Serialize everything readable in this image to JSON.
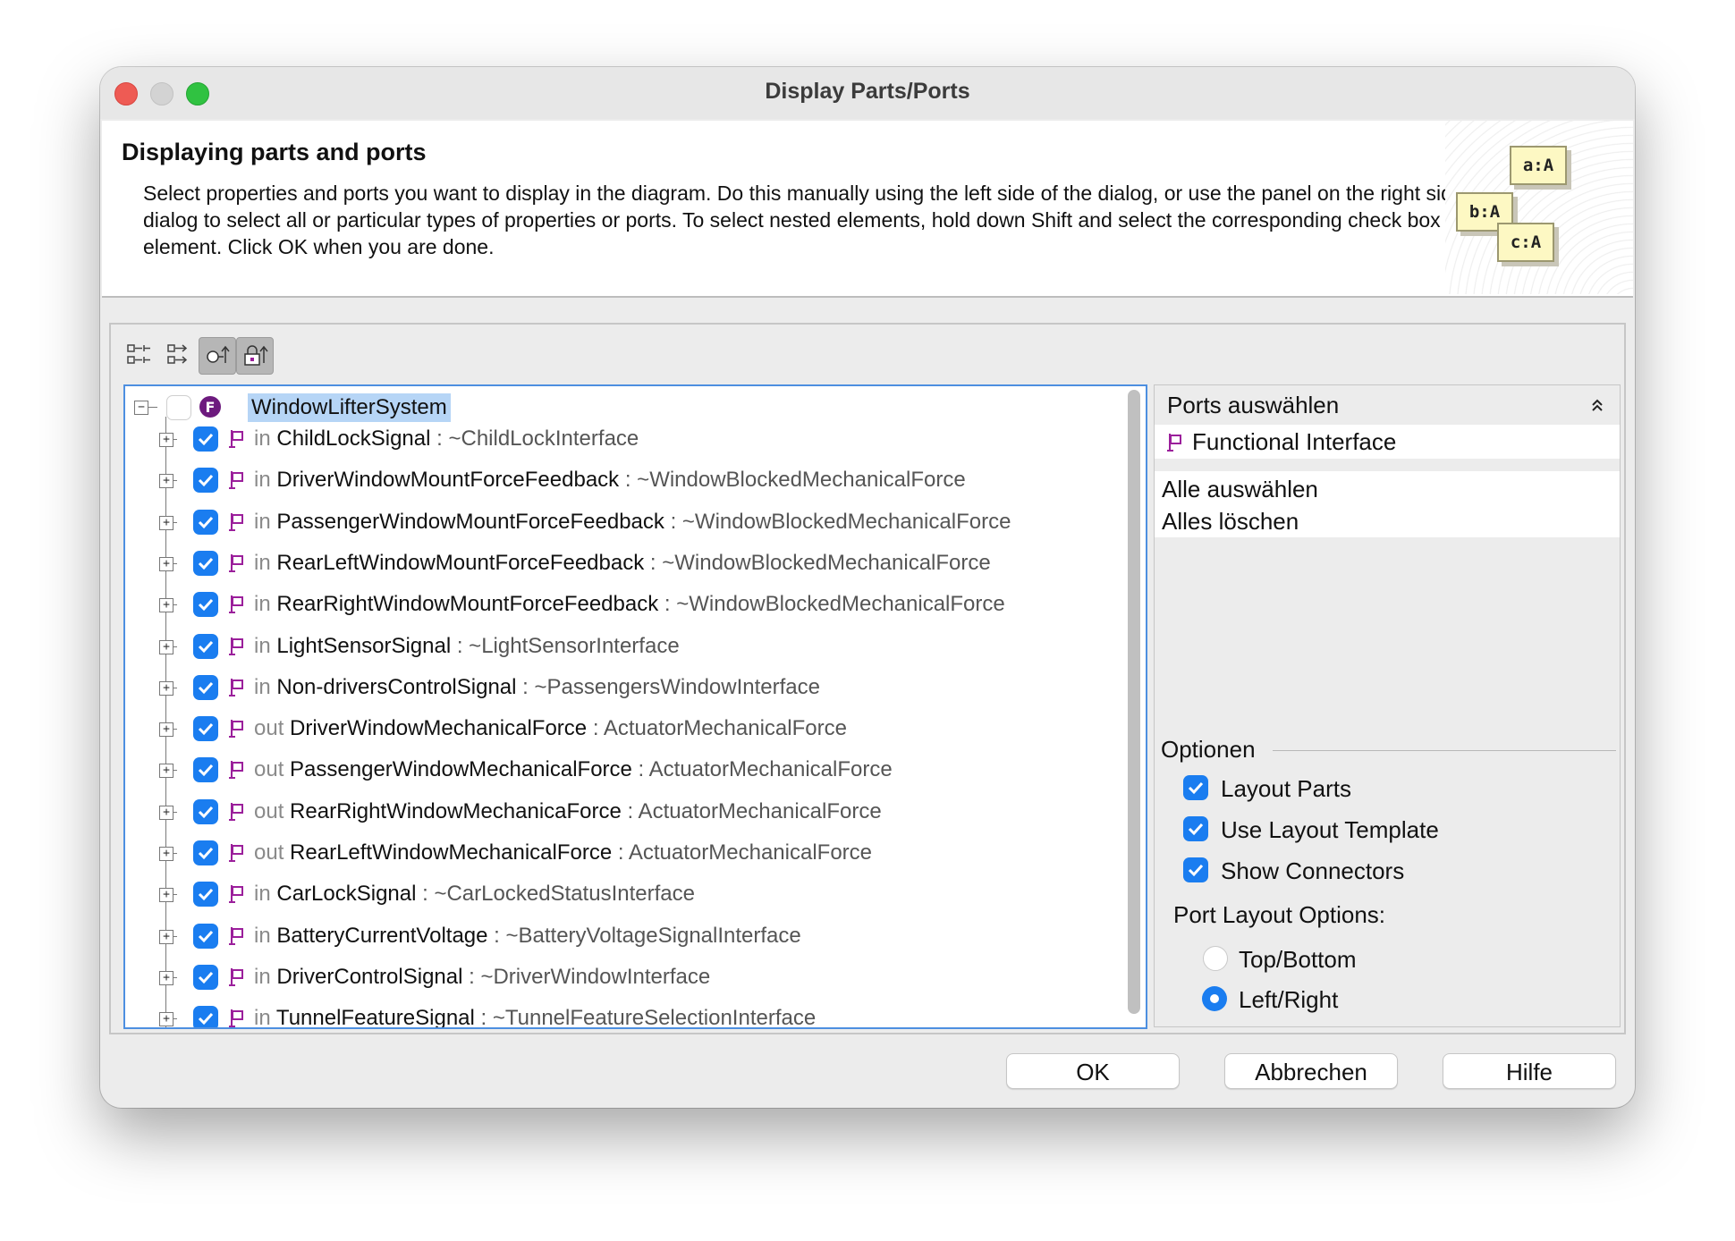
{
  "window": {
    "title": "Display Parts/Ports"
  },
  "header": {
    "title": "Displaying parts and ports",
    "description": "Select properties and ports you want to display in the diagram. Do this manually using the left side of the dialog, or use the panel on the right side of the dialog to select all or particular types of properties or ports. To select nested elements, hold down Shift and select the corresponding check box for the element. Click OK when you are done.",
    "deco_boxes": [
      "a:A",
      "b:A",
      "c:A"
    ]
  },
  "tree": {
    "root": {
      "label": "WindowLifterSystem",
      "badge": "F"
    },
    "items": [
      {
        "dir": "in",
        "name": "ChildLockSignal",
        "type": " : ~ChildLockInterface"
      },
      {
        "dir": "in",
        "name": "DriverWindowMountForceFeedback",
        "type": " : ~WindowBlockedMechanicalForce"
      },
      {
        "dir": "in",
        "name": "PassengerWindowMountForceFeedback",
        "type": " : ~WindowBlockedMechanicalForce"
      },
      {
        "dir": "in",
        "name": "RearLeftWindowMountForceFeedback",
        "type": " : ~WindowBlockedMechanicalForce"
      },
      {
        "dir": "in",
        "name": "RearRightWindowMountForceFeedback",
        "type": " : ~WindowBlockedMechanicalForce"
      },
      {
        "dir": "in",
        "name": "LightSensorSignal",
        "type": " : ~LightSensorInterface"
      },
      {
        "dir": "in",
        "name": "Non-driversControlSignal",
        "type": " : ~PassengersWindowInterface"
      },
      {
        "dir": "out",
        "name": "DriverWindowMechanicalForce",
        "type": " : ActuatorMechanicalForce"
      },
      {
        "dir": "out",
        "name": "PassengerWindowMechanicalForce",
        "type": " : ActuatorMechanicalForce"
      },
      {
        "dir": "out",
        "name": "RearRightWindowMechanicaForce",
        "type": " : ActuatorMechanicalForce"
      },
      {
        "dir": "out",
        "name": "RearLeftWindowMechanicalForce",
        "type": " : ActuatorMechanicalForce"
      },
      {
        "dir": "in",
        "name": "CarLockSignal",
        "type": " : ~CarLockedStatusInterface"
      },
      {
        "dir": "in",
        "name": "BatteryCurrentVoltage",
        "type": " : ~BatteryVoltageSignalInterface"
      },
      {
        "dir": "in",
        "name": "DriverControlSignal",
        "type": " : ~DriverWindowInterface"
      },
      {
        "dir": "in",
        "name": "TunnelFeatureSignal",
        "type": " : ~TunnelFeatureSelectionInterface"
      }
    ]
  },
  "right_panel": {
    "header": "Ports auswählen",
    "type_item": "Functional Interface",
    "select_all": "Alle auswählen",
    "clear_all": "Alles löschen",
    "options_title": "Optionen",
    "options": [
      "Layout Parts",
      "Use Layout Template",
      "Show Connectors"
    ],
    "port_layout_title": "Port Layout Options:",
    "port_layout": [
      {
        "label": "Top/Bottom",
        "selected": false
      },
      {
        "label": "Left/Right",
        "selected": true
      }
    ]
  },
  "buttons": {
    "ok": "OK",
    "cancel": "Abbrechen",
    "help": "Hilfe"
  },
  "colors": {
    "accent": "#1a7df0",
    "port_icon": "#9b1f9b",
    "badge": "#6d1a7e",
    "selection": "#b6d5f6"
  }
}
